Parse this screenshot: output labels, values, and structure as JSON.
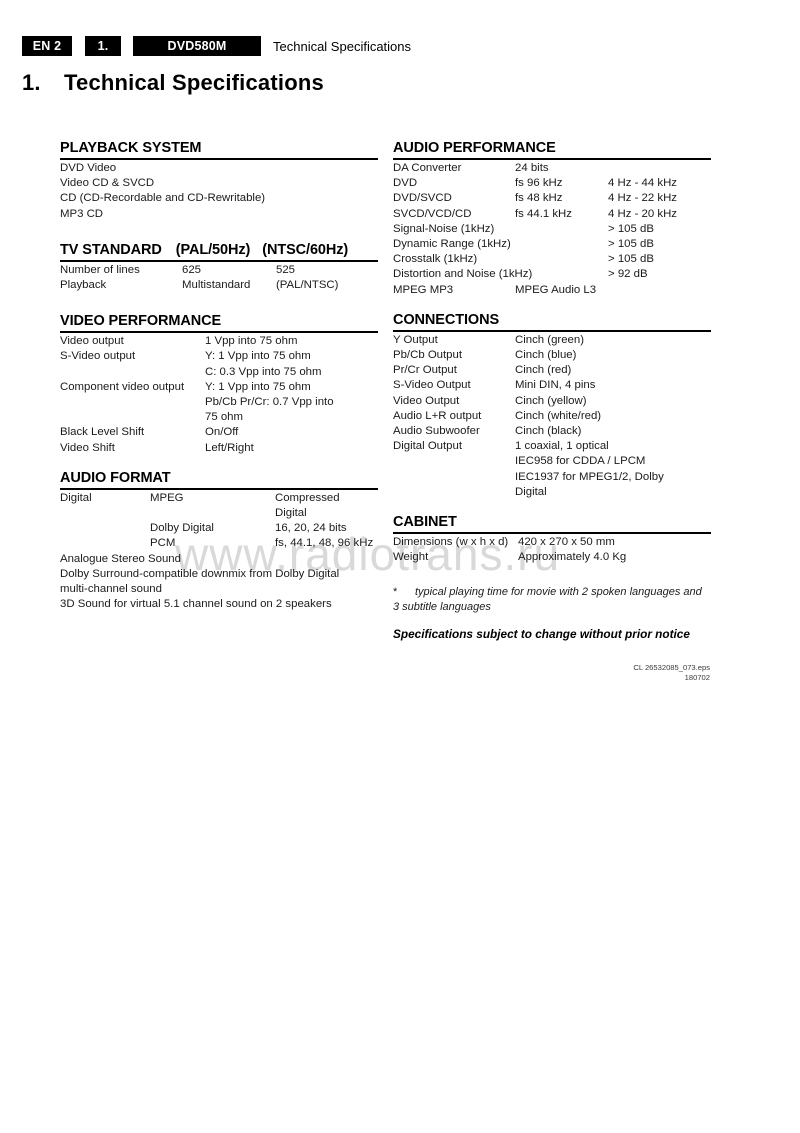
{
  "header": {
    "lang_box": "EN 2",
    "chapter_box": "1.",
    "model_box": "DVD580M",
    "section_title": "Technical Specifications"
  },
  "chapter": {
    "number": "1.",
    "title": "Technical Specifications"
  },
  "watermark": "www.radiotrans.ru",
  "left_column": {
    "playback_system": {
      "heading": "PLAYBACK SYSTEM",
      "lines": [
        "DVD Video",
        "Video CD & SVCD",
        "CD (CD-Recordable and CD-Rewritable)",
        "MP3 CD"
      ]
    },
    "tv_standard": {
      "heading": "TV STANDARD",
      "heading_col2": "(PAL/50Hz)",
      "heading_col3": "(NTSC/60Hz)",
      "rows": [
        {
          "label": "Number of lines",
          "pal": "625",
          "ntsc": "525"
        },
        {
          "label": "Playback",
          "pal": "Multistandard",
          "ntsc": "(PAL/NTSC)"
        }
      ]
    },
    "video_performance": {
      "heading": "VIDEO PERFORMANCE",
      "rows": [
        {
          "label": "Video output",
          "value": "1 Vpp into 75 ohm"
        },
        {
          "label": "S-Video output",
          "value": "Y: 1 Vpp into 75 ohm"
        },
        {
          "label": "",
          "value": "C: 0.3 Vpp into 75 ohm"
        },
        {
          "label": "Component video output",
          "value": "Y: 1 Vpp into 75 ohm"
        },
        {
          "label": "",
          "value": "Pb/Cb Pr/Cr: 0.7 Vpp into"
        },
        {
          "label": "",
          "value": "75 ohm"
        },
        {
          "label": "Black Level Shift",
          "value": "On/Off"
        },
        {
          "label": "Video Shift",
          "value": "Left/Right"
        }
      ]
    },
    "audio_format": {
      "heading": "AUDIO FORMAT",
      "rows": [
        {
          "c1": "Digital",
          "c2": "MPEG",
          "c3": "Compressed"
        },
        {
          "c1": "",
          "c2": "",
          "c3": "Digital"
        },
        {
          "c1": "",
          "c2": "Dolby Digital",
          "c3": "16, 20, 24 bits"
        },
        {
          "c1": "",
          "c2": "PCM",
          "c3": "fs, 44.1, 48, 96 kHz"
        }
      ],
      "lines": [
        "Analogue Stereo Sound",
        "Dolby Surround-compatible downmix from Dolby Digital",
        "multi-channel sound",
        "3D Sound for virtual 5.1 channel sound on 2 speakers"
      ]
    }
  },
  "right_column": {
    "audio_performance": {
      "heading": "AUDIO PERFORMANCE",
      "rows": [
        {
          "c1": "DA Converter",
          "c2": "24 bits",
          "c3": ""
        },
        {
          "c1": "DVD",
          "c2": "fs 96 kHz",
          "c3": "4 Hz - 44 kHz"
        },
        {
          "c1": "DVD/SVCD",
          "c2": "fs 48 kHz",
          "c3": "4 Hz - 22 kHz"
        },
        {
          "c1": "SVCD/VCD/CD",
          "c2": "fs 44.1 kHz",
          "c3": "4 Hz - 20 kHz"
        },
        {
          "c1": "Signal-Noise (1kHz)",
          "c2": "",
          "c3": "> 105 dB"
        },
        {
          "c1": "Dynamic Range (1kHz)",
          "c2": "",
          "c3": "> 105 dB"
        },
        {
          "c1": "Crosstalk (1kHz)",
          "c2": "",
          "c3": "> 105 dB"
        },
        {
          "c1": "Distortion and Noise (1kHz)",
          "c2": "",
          "c3": "> 92 dB"
        },
        {
          "c1": "MPEG MP3",
          "c2": "MPEG Audio L3",
          "c3": ""
        }
      ]
    },
    "connections": {
      "heading": "CONNECTIONS",
      "rows": [
        {
          "label": "Y Output",
          "value": "Cinch (green)"
        },
        {
          "label": "Pb/Cb Output",
          "value": "Cinch (blue)"
        },
        {
          "label": "Pr/Cr Output",
          "value": "Cinch (red)"
        },
        {
          "label": "S-Video Output",
          "value": "Mini DIN, 4 pins"
        },
        {
          "label": "Video Output",
          "value": "Cinch (yellow)"
        },
        {
          "label": "Audio L+R output",
          "value": "Cinch (white/red)"
        },
        {
          "label": "Audio Subwoofer",
          "value": "Cinch (black)"
        },
        {
          "label": "Digital Output",
          "value": "1 coaxial, 1 optical"
        },
        {
          "label": "",
          "value": "IEC958 for CDDA / LPCM"
        },
        {
          "label": "",
          "value": "IEC1937 for MPEG1/2, Dolby"
        },
        {
          "label": "",
          "value": "Digital"
        }
      ]
    },
    "cabinet": {
      "heading": "CABINET",
      "rows": [
        {
          "label": "Dimensions (w x h x d)",
          "value": "420 x 270 x 50 mm"
        },
        {
          "label": "Weight",
          "value": "Approximately 4.0 Kg"
        }
      ]
    },
    "footnote_star": "*",
    "footnote_line1": "typical playing time for movie with 2 spoken languages and",
    "footnote_line2": "3 subtitle languages",
    "notice": "Specifications subject to change without prior notice"
  },
  "doc_ref": {
    "eps": "CL 26532085_073.eps",
    "date_code": "180702"
  }
}
